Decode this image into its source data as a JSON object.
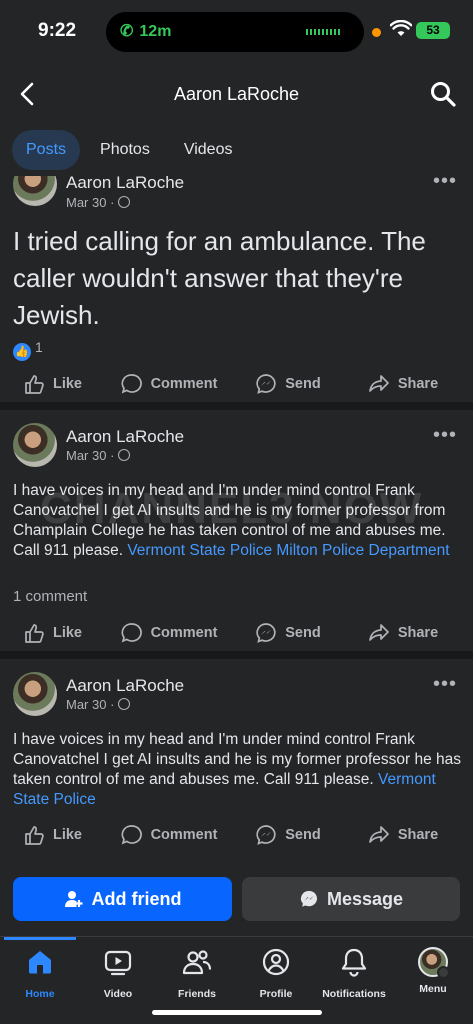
{
  "status": {
    "time": "9:22",
    "call": "12m",
    "battery": "53"
  },
  "header": {
    "title": "Aaron LaRoche"
  },
  "tabs": [
    {
      "label": "Posts",
      "active": true
    },
    {
      "label": "Photos"
    },
    {
      "label": "Videos"
    }
  ],
  "posts": [
    {
      "author": "Aaron LaRoche",
      "date": "Mar 30 ·",
      "text": "I tried calling for an ambulance. The caller wouldn't answer that they're Jewish.",
      "reactions": "1"
    },
    {
      "author": "Aaron LaRoche",
      "date": "Mar 30 ·",
      "text": "I have voices in my head and I'm under mind control Frank Canovatchel I get AI insults and he is my former professor from Champlain College he has taken control of me and abuses me. Call 911 please.",
      "link": "Vermont State Police Milton Police Department",
      "comments": "1 comment"
    },
    {
      "author": "Aaron LaRoche",
      "date": "Mar 30 ·",
      "text": "I have voices in my head and I'm under mind control Frank Canovatchel I get AI insults and he is my former professor he has taken control of me and abuses me. Call 911 please.",
      "link": "Vermont State Police"
    }
  ],
  "actions": {
    "like": "Like",
    "comment": "Comment",
    "send": "Send",
    "share": "Share"
  },
  "watermark": "CHANNEL3 NOW",
  "friendbar": {
    "add": "Add friend",
    "message": "Message"
  },
  "nav": [
    {
      "label": "Home",
      "active": true
    },
    {
      "label": "Video"
    },
    {
      "label": "Friends"
    },
    {
      "label": "Profile"
    },
    {
      "label": "Notifications"
    },
    {
      "label": "Menu"
    }
  ]
}
